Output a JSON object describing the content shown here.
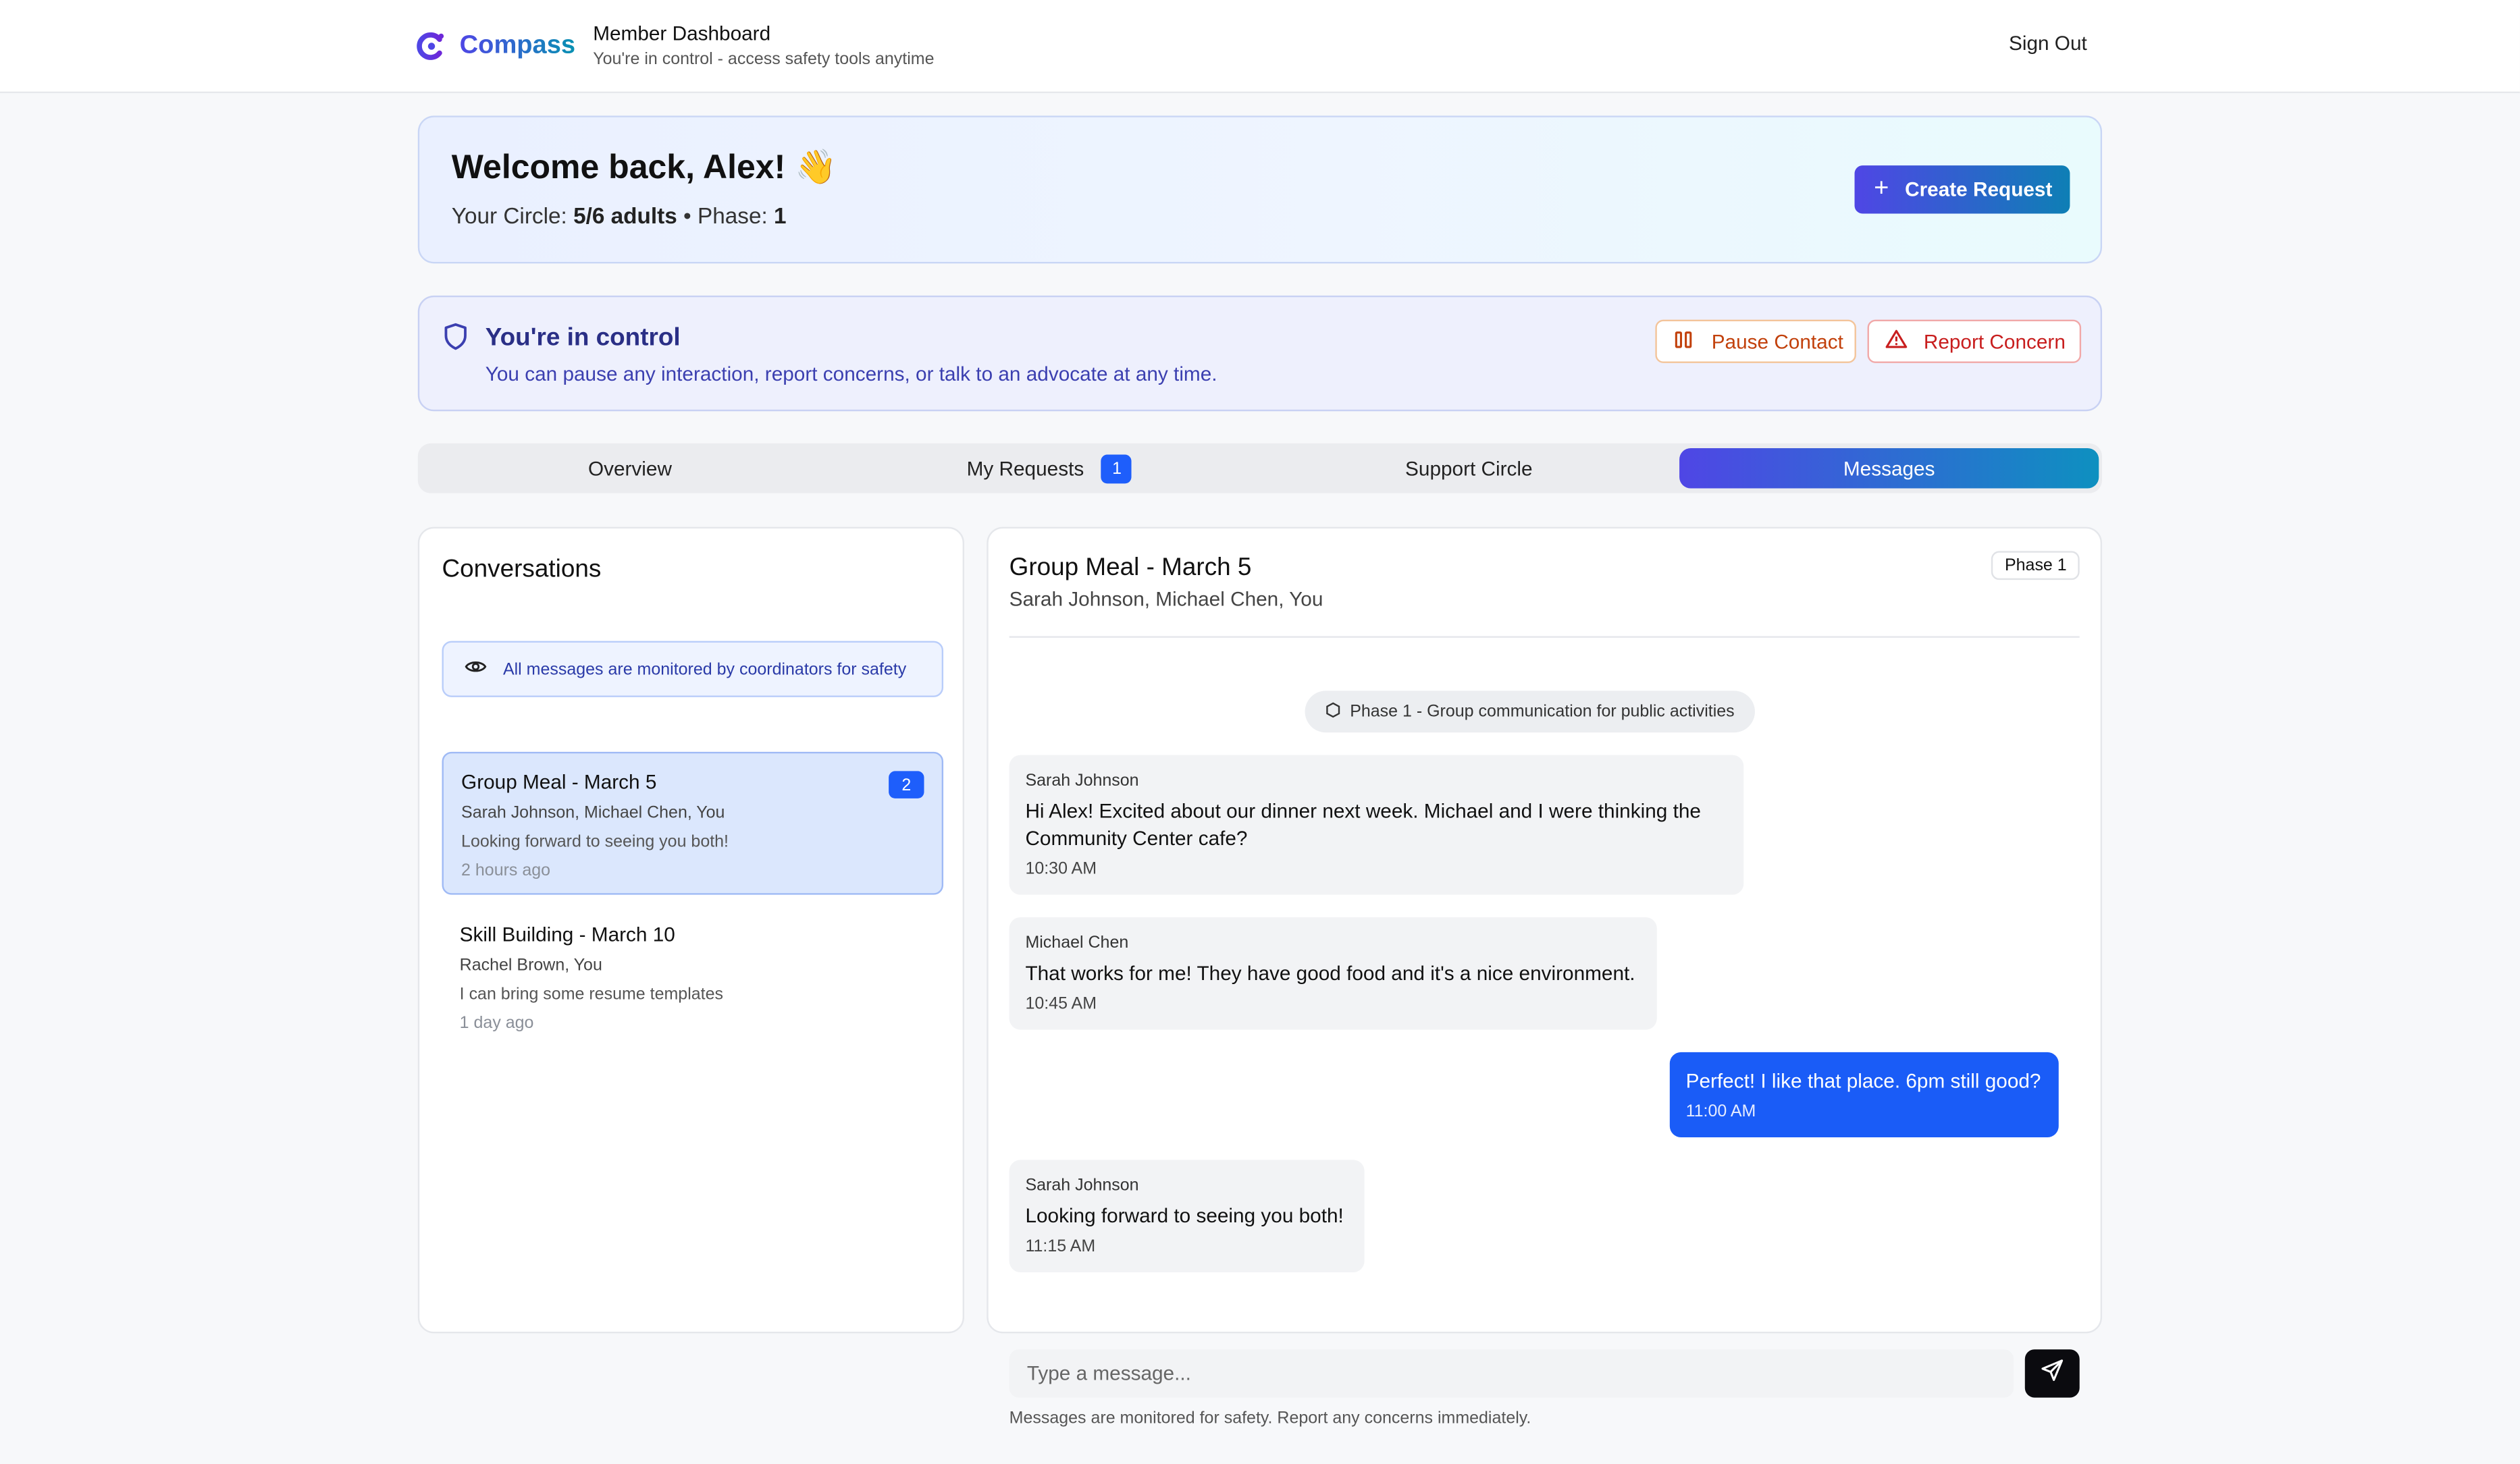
{
  "header": {
    "brand": "Compass",
    "title": "Member Dashboard",
    "subtitle": "You're in control - access safety tools anytime",
    "sign_out": "Sign Out"
  },
  "welcome": {
    "title": "Welcome back, Alex! 👋",
    "circle_label": "Your Circle:",
    "circle_value": "5/6 adults",
    "separator": "•",
    "phase_label": "Phase:",
    "phase_value": "1",
    "create_button": "Create Request"
  },
  "control": {
    "title": "You're in control",
    "subtitle": "You can pause any interaction, report concerns, or talk to an advocate at any time.",
    "pause_button": "Pause Contact",
    "report_button": "Report Concern"
  },
  "tabs": [
    {
      "label": "Overview"
    },
    {
      "label": "My Requests",
      "badge": "1"
    },
    {
      "label": "Support Circle"
    },
    {
      "label": "Messages",
      "active": true
    }
  ],
  "conversations": {
    "title": "Conversations",
    "monitor_note": "All messages are monitored by coordinators for safety",
    "items": [
      {
        "title": "Group Meal - March 5",
        "people": "Sarah Johnson, Michael Chen, You",
        "last": "Looking forward to seeing you both!",
        "time": "2 hours ago",
        "badge": "2"
      },
      {
        "title": "Skill Building - March 10",
        "people": "Rachel Brown, You",
        "last": "I can bring some resume templates",
        "time": "1 day ago"
      }
    ]
  },
  "chat": {
    "title": "Group Meal - March 5",
    "people": "Sarah Johnson, Michael Chen, You",
    "phase": "Phase 1",
    "system": "Phase 1 - Group communication for public activities",
    "messages": [
      {
        "sender": "Sarah Johnson",
        "text": "Hi Alex! Excited about our dinner next week. Michael and I were thinking the Community Center cafe?",
        "time": "10:30 AM"
      },
      {
        "sender": "Michael Chen",
        "text": "That works for me! They have good food and it's a nice environment.",
        "time": "10:45 AM"
      },
      {
        "text": "Perfect! I like that place. 6pm still good?",
        "time": "11:00 AM"
      },
      {
        "sender": "Sarah Johnson",
        "text": "Looking forward to seeing you both!",
        "time": "11:15 AM"
      }
    ],
    "input_placeholder": "Type a message...",
    "footer_note": "Messages are monitored for safety. Report any concerns immediately."
  },
  "colors": {
    "accent_start": "#4f46e5",
    "accent_end": "#0891b2",
    "badge": "#1e5efb",
    "outgoing_bubble": "#1a5cf7"
  },
  "icons": [
    "compass-logo-icon",
    "plus-icon",
    "shield-icon",
    "pause-icon",
    "alert-triangle-icon",
    "eye-icon",
    "send-icon"
  ]
}
